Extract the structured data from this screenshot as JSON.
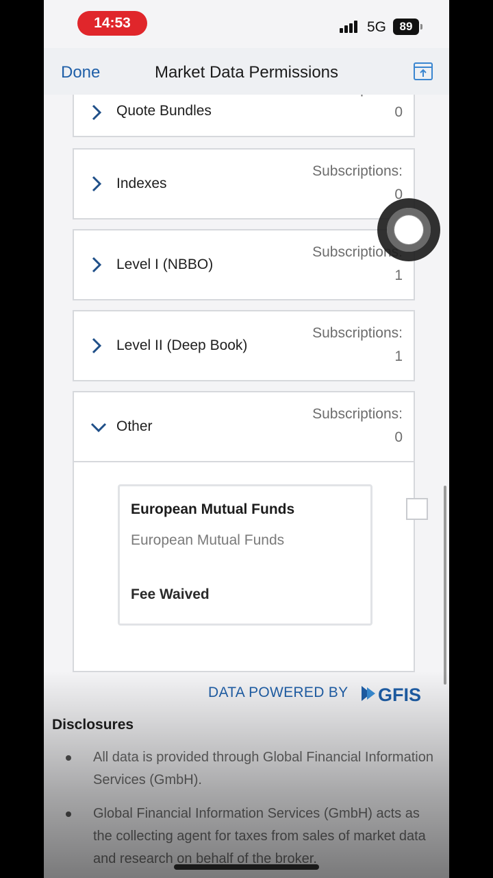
{
  "status_bar": {
    "time": "14:53",
    "network": "5G",
    "battery": "89"
  },
  "nav": {
    "done_label": "Done",
    "title": "Market Data Permissions"
  },
  "subscriptions_label": "Subscriptions:",
  "categories": [
    {
      "label": "Quote Bundles",
      "count": "0",
      "expanded": false
    },
    {
      "label": "Indexes",
      "count": "0",
      "expanded": false
    },
    {
      "label": "Level I (NBBO)",
      "count": "1",
      "expanded": false
    },
    {
      "label": "Level II (Deep Book)",
      "count": "1",
      "expanded": false
    },
    {
      "label": "Other",
      "count": "0",
      "expanded": true
    }
  ],
  "other_items": [
    {
      "title": "European Mutual Funds",
      "subtitle": "European Mutual Funds",
      "fee": "Fee Waived",
      "checked": false
    }
  ],
  "powered_by": "DATA POWERED BY",
  "logo_text": "GFIS",
  "disclosures": {
    "title": "Disclosures",
    "items": [
      "All data is provided through Global Financial Information Services (GmbH).",
      "Global Financial Information Services (GmbH) acts as the collecting agent for taxes from sales of market data and research on behalf of the broker."
    ]
  },
  "colors": {
    "accent": "#1f5fa8",
    "time_pill": "#e0262b"
  }
}
